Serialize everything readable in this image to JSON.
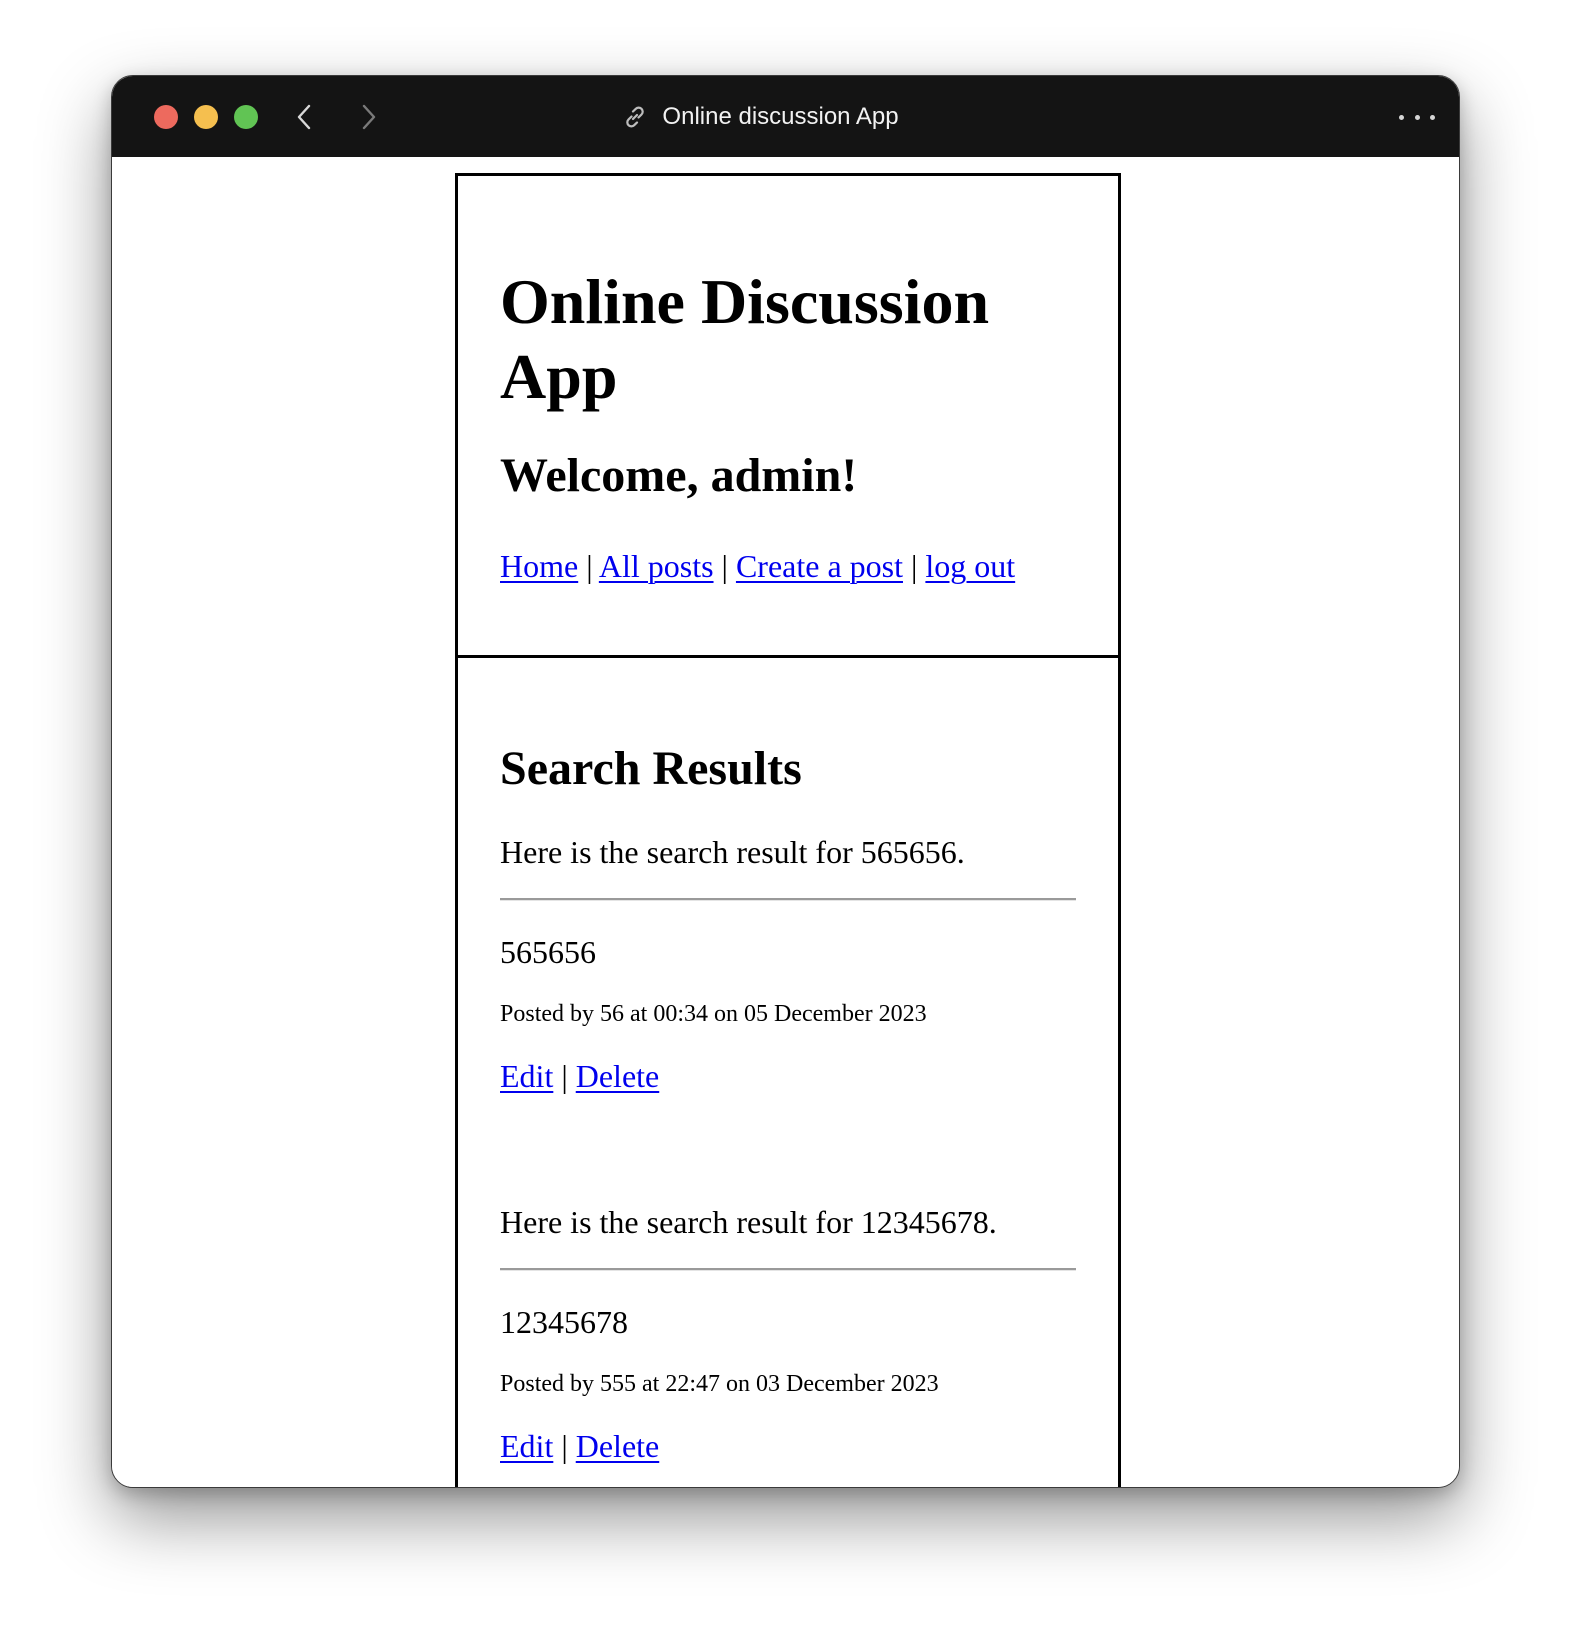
{
  "window": {
    "title": "Online discussion App"
  },
  "header": {
    "app_title": "Online Discussion App",
    "welcome": "Welcome, admin!",
    "nav": [
      {
        "label": "Home"
      },
      {
        "label": "All posts"
      },
      {
        "label": "Create a post"
      },
      {
        "label": "log out"
      }
    ],
    "separator": "|"
  },
  "main": {
    "title": "Search Results",
    "results": [
      {
        "intro": "Here is the search result for 565656.",
        "post_title": "565656",
        "meta": "Posted by 56 at 00:34 on 05 December 2023",
        "edit_label": "Edit",
        "delete_label": "Delete"
      },
      {
        "intro": "Here is the search result for 12345678.",
        "post_title": "12345678",
        "meta": "Posted by 555 at 22:47 on 03 December 2023",
        "edit_label": "Edit",
        "delete_label": "Delete"
      }
    ]
  },
  "colors": {
    "titlebar": "#141414",
    "link": "#0000ee",
    "traffic_red": "#ed6a5e",
    "traffic_yellow": "#f5bf4f",
    "traffic_green": "#61c454"
  }
}
